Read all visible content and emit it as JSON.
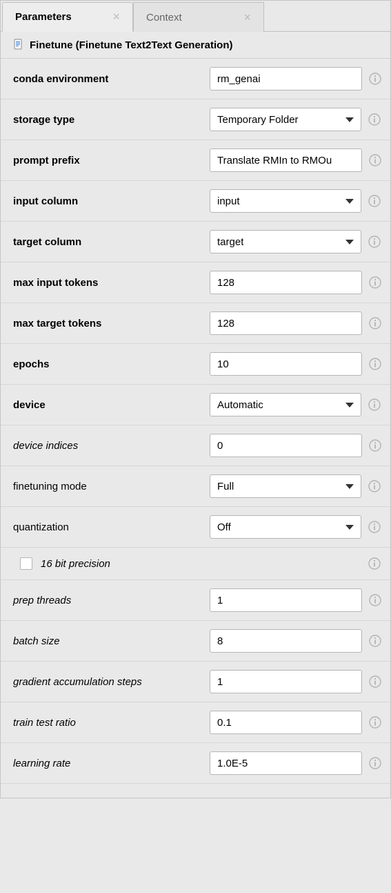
{
  "tabs": {
    "parameters": "Parameters",
    "context": "Context"
  },
  "subtitle": "Finetune (Finetune Text2Text Generation)",
  "params": {
    "conda_env": {
      "label": "conda environment",
      "value": "rm_genai"
    },
    "storage_type": {
      "label": "storage type",
      "value": "Temporary Folder"
    },
    "prompt_prefix": {
      "label": "prompt prefix",
      "value": "Translate RMIn to RMOu"
    },
    "input_column": {
      "label": "input column",
      "value": "input"
    },
    "target_column": {
      "label": "target column",
      "value": "target"
    },
    "max_input_tokens": {
      "label": "max input tokens",
      "value": "128"
    },
    "max_target_tokens": {
      "label": "max target tokens",
      "value": "128"
    },
    "epochs": {
      "label": "epochs",
      "value": "10"
    },
    "device": {
      "label": "device",
      "value": "Automatic"
    },
    "device_indices": {
      "label": "device indices",
      "value": "0"
    },
    "finetuning_mode": {
      "label": "finetuning mode",
      "value": "Full"
    },
    "quantization": {
      "label": "quantization",
      "value": "Off"
    },
    "precision16": {
      "label": "16 bit precision",
      "checked": false
    },
    "prep_threads": {
      "label": "prep threads",
      "value": "1"
    },
    "batch_size": {
      "label": "batch size",
      "value": "8"
    },
    "grad_accum": {
      "label": "gradient accumulation steps",
      "value": "1"
    },
    "train_test_ratio": {
      "label": "train test ratio",
      "value": "0.1"
    },
    "learning_rate": {
      "label": "learning rate",
      "value": "1.0E-5"
    }
  }
}
